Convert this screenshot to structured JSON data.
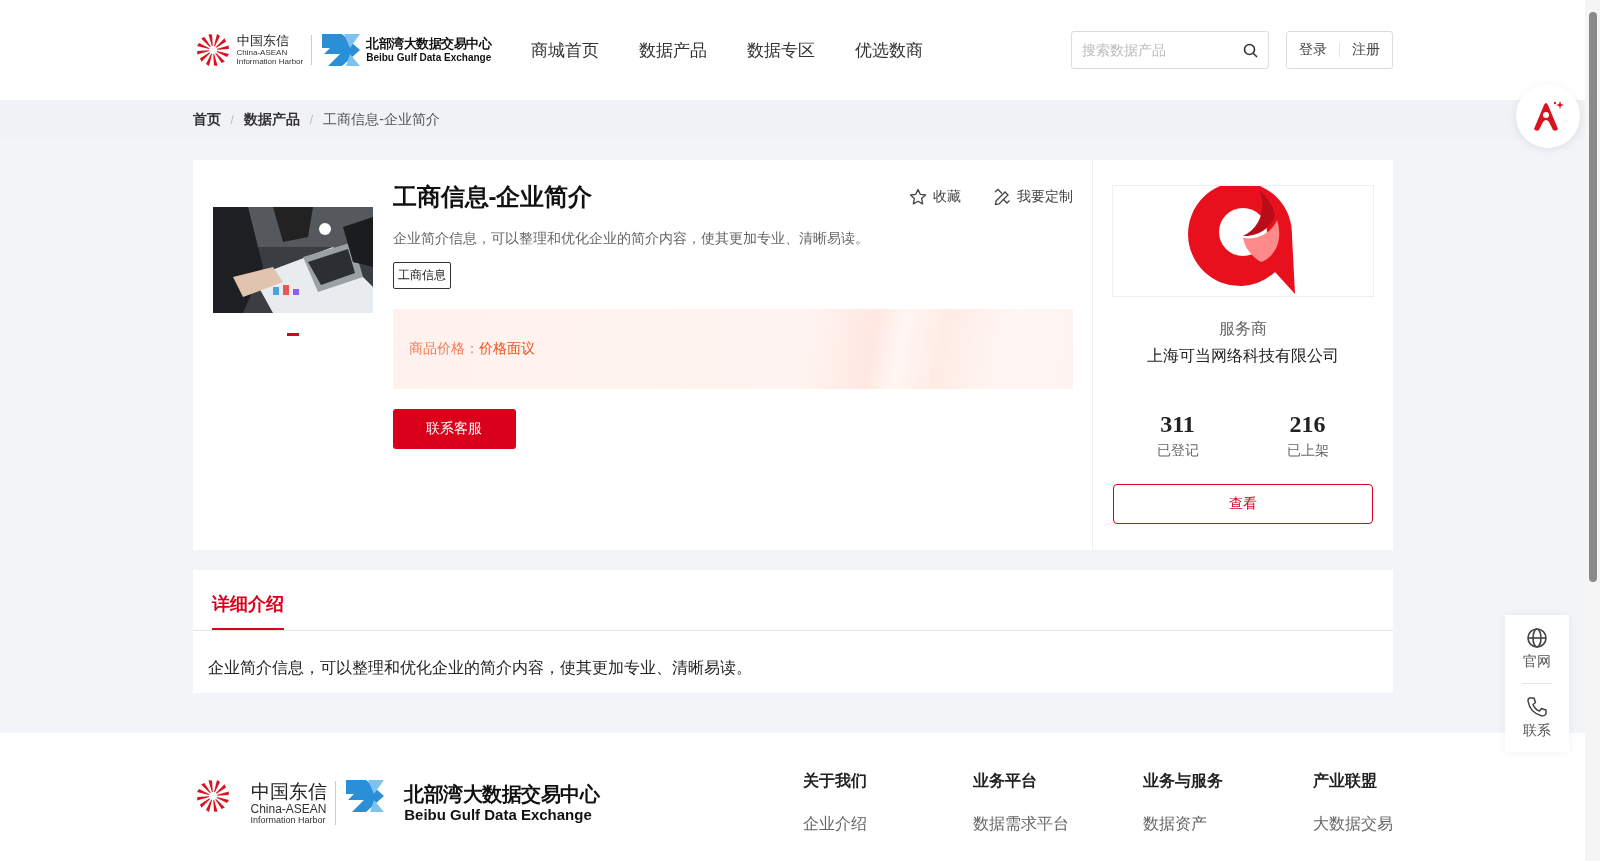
{
  "header": {
    "logo": {
      "cn": "中国东信",
      "en1": "China-ASEAN",
      "en2": "Information Harbor",
      "exchange_cn": "北部湾大数据交易中心",
      "exchange_en": "Beibu Gulf Data Exchange"
    },
    "nav": [
      {
        "label": "商城首页",
        "selected": false
      },
      {
        "label": "数据产品",
        "selected": false
      },
      {
        "label": "数据专区",
        "selected": false
      },
      {
        "label": "优选数商",
        "selected": false
      }
    ],
    "search": {
      "placeholder": "搜索数据产品"
    },
    "auth": [
      "登录",
      "注册"
    ]
  },
  "breadcrumb": [
    {
      "label": "首页",
      "current": false
    },
    {
      "separator": "/",
      "label": "数据产品",
      "current": false
    },
    {
      "separator": "/",
      "label": "工商信息-企业简介",
      "current": true
    }
  ],
  "product": {
    "carousel": [
      {
        "selected": true
      }
    ],
    "title": "工商信息-企业简介",
    "actions": [
      {
        "kind": "favorite",
        "label": "收藏"
      },
      {
        "kind": "customize",
        "label": "我要定制"
      }
    ],
    "description": "企业简介信息，可以整理和优化企业的简介内容，使其更加专业、清晰易读。",
    "tags": [
      "工商信息"
    ],
    "price": "商品价格：**价格面议**",
    "contact_button": "联系客服"
  },
  "vendor": {
    "role": "服务商",
    "name": "上海可当网络科技有限公司",
    "stats": [
      {
        "value": "311",
        "label": "已登记"
      },
      {
        "value": "216",
        "label": "已上架"
      }
    ],
    "button": "查看"
  },
  "details": {
    "tabs": [
      {
        "label": "详细介绍",
        "selected": true
      }
    ],
    "text": "企业简介信息，可以整理和优化企业的简介内容，使其更加专业、清晰易读。"
  },
  "footer": {
    "logo": {
      "cn": "中国东信",
      "en1": "China-ASEAN",
      "en2": "Information Harbor",
      "exchange_cn": "北部湾大数据交易中心",
      "exchange_en": "Beibu Gulf Data Exchange"
    },
    "columns": [
      {
        "heading": "关于我们",
        "links": [
          "企业介绍"
        ]
      },
      {
        "heading": "业务平台",
        "links": [
          "数据需求平台"
        ]
      },
      {
        "heading": "业务与服务",
        "links": [
          "数据资产"
        ]
      },
      {
        "heading": "产业联盟",
        "links": [
          "大数据交易"
        ]
      }
    ]
  },
  "side_tools": [
    {
      "kind": "globe",
      "label": "官网"
    },
    {
      "kind": "phone",
      "label": "联系"
    }
  ]
}
